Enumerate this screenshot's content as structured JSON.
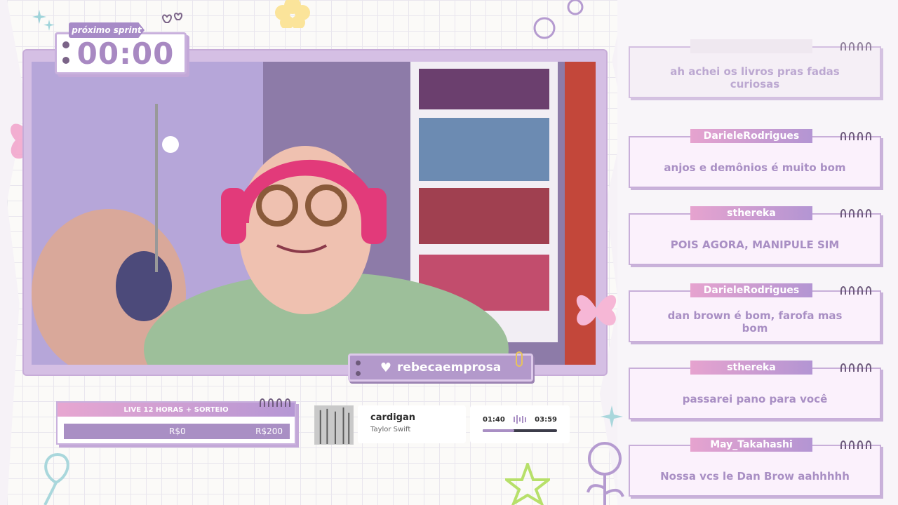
{
  "timer": {
    "label": "próximo sprint",
    "value": "00:00"
  },
  "streamer": {
    "name": "rebecaemprosa"
  },
  "goal": {
    "title": "LIVE 12 HORAS + SORTEIO",
    "current": "R$0",
    "target": "R$200",
    "progress": 0
  },
  "music": {
    "title": "cardigan",
    "artist": "Taylor Swift",
    "elapsed": "01:40",
    "duration": "03:59",
    "progress": 0.42
  },
  "chat": [
    {
      "user": "",
      "text": "ah achei os livros pras fadas curiosas"
    },
    {
      "user": "DarieleRodrigues",
      "text": "anjos e demônios é muito bom"
    },
    {
      "user": "sthereka",
      "text": "POIS AGORA, MANIPULE SIM"
    },
    {
      "user": "DarieleRodrigues",
      "text": "dan brown é bom, farofa mas bom"
    },
    {
      "user": "sthereka",
      "text": "passarei pano para você"
    },
    {
      "user": "May_Takahashi",
      "text": "Nossa vcs le Dan Brow aahhhhh"
    }
  ],
  "colors": {
    "accent": "#a98fc4",
    "pink": "#e6a3cf",
    "frame": "#d5bfe4"
  },
  "icons": {
    "heart": "heart-icon",
    "clip": "paperclip-icon"
  }
}
